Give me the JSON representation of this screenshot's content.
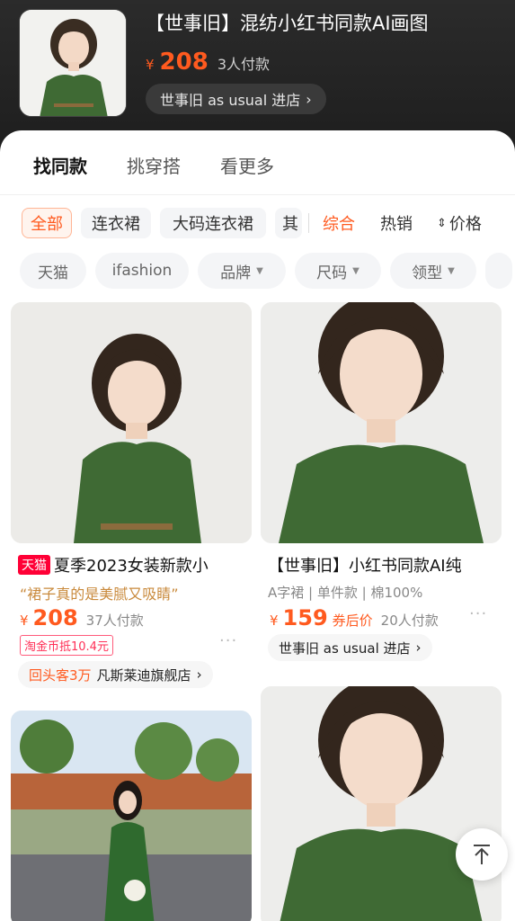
{
  "header": {
    "title": "【世事旧】混纺小红书同款AI画图",
    "currency": "¥",
    "price": "208",
    "paid_count": "3人付款",
    "store": "世事旧 as usual 进店"
  },
  "tabs": [
    {
      "label": "找同款"
    },
    {
      "label": "挑穿搭"
    },
    {
      "label": "看更多"
    }
  ],
  "filters": {
    "chips": [
      {
        "label": "全部"
      },
      {
        "label": "连衣裙"
      },
      {
        "label": "大码连衣裙"
      },
      {
        "label": "其"
      }
    ],
    "sort": [
      {
        "label": "综合"
      },
      {
        "label": "热销"
      },
      {
        "label": "价格"
      }
    ]
  },
  "pills": [
    {
      "label": "天猫"
    },
    {
      "label": "ifashion"
    },
    {
      "label": "品牌"
    },
    {
      "label": "尺码"
    },
    {
      "label": "领型"
    }
  ],
  "products": [
    {
      "badge": "天猫",
      "title": "夏季2023女装新款小",
      "quote": "“裙子真的是美腻又吸睛”",
      "currency": "¥",
      "price": "208",
      "paid": "37人付款",
      "coupon_tag": "淘金币抵10.4元",
      "store_highlight": "回头客3万",
      "store_name": "凡斯莱迪旗舰店"
    },
    {
      "title": "【世事旧】小红书同款AI纯",
      "attrs": "A字裙 | 单件款 | 棉100%",
      "currency": "¥",
      "price": "159",
      "coupon_label": "券后价",
      "paid": "20人付款",
      "store_name": "世事旧 as usual 进店"
    }
  ],
  "colors": {
    "accent": "#ff5a1f",
    "dress_green": "#3f6a34",
    "header_bg": "#1e1e1e"
  },
  "icons": {
    "chevron": "›",
    "more": "···",
    "back_to_top": "back-to-top-icon"
  }
}
